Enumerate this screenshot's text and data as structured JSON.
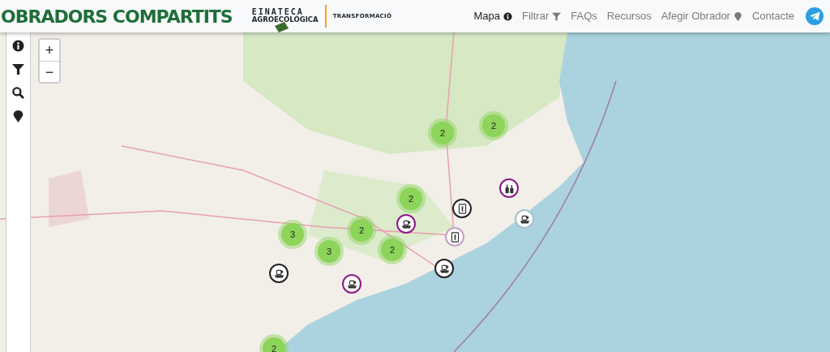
{
  "brand": {
    "title": "OBRADORS COMPARTITS",
    "logo_line_1": "EINATECA",
    "logo_line_2": "AGROECOLÒGICA",
    "logo_tag": "TRANSFORMACIÓ"
  },
  "nav": [
    {
      "label": "Mapa",
      "selected": true,
      "kind": "info"
    },
    {
      "label": "Filtrar",
      "selected": false,
      "kind": "filter"
    },
    {
      "label": "FAQs",
      "selected": false,
      "kind": "plain"
    },
    {
      "label": "Recursos",
      "selected": false,
      "kind": "plain"
    },
    {
      "label": "Afegir Obrador",
      "selected": false,
      "kind": "pin"
    },
    {
      "label": "Contacte",
      "selected": false,
      "kind": "plain"
    }
  ],
  "sidebar": [
    {
      "kind": "info"
    },
    {
      "kind": "filter"
    },
    {
      "kind": "search"
    },
    {
      "kind": "pin"
    }
  ],
  "zoom": {
    "in": "+",
    "out": "−"
  },
  "clusters": [
    {
      "count": "2"
    },
    {
      "count": "2"
    },
    {
      "count": "2"
    },
    {
      "count": "2"
    },
    {
      "count": "2"
    },
    {
      "count": "3"
    },
    {
      "count": "3"
    },
    {
      "count": "2"
    }
  ],
  "markers": [
    {
      "kind": "bottles",
      "color": "#8b1a89"
    },
    {
      "kind": "jar",
      "color": "#222222"
    },
    {
      "kind": "food",
      "color": "#8b1a89"
    },
    {
      "kind": "jar",
      "color": "#c79fc6"
    },
    {
      "kind": "food",
      "color": "#a9bfcc"
    },
    {
      "kind": "food",
      "color": "#222222"
    },
    {
      "kind": "food",
      "color": "#8b1a89"
    },
    {
      "kind": "food",
      "color": "#222222"
    }
  ]
}
